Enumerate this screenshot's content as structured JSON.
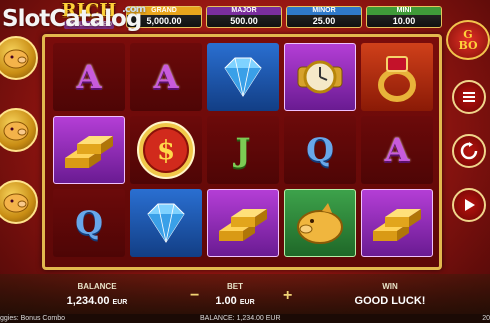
{
  "watermark": {
    "text": "SlotCatalog",
    "suffix": ".com"
  },
  "logo": {
    "title": "RICH",
    "subtitle": "BONUS COMBO"
  },
  "jackpots": [
    {
      "label": "GRAND",
      "value": "5,000.00"
    },
    {
      "label": "MAJOR",
      "value": "500.00"
    },
    {
      "label": "MINOR",
      "value": "25.00"
    },
    {
      "label": "MINI",
      "value": "10.00"
    }
  ],
  "reels": [
    [
      "A",
      "A",
      "diamond",
      "watch",
      "ring"
    ],
    [
      "gold-bars",
      "dollar-coin",
      "J",
      "Q",
      "A"
    ],
    [
      "Q",
      "diamond",
      "gold-bars",
      "golden-pig",
      "gold-bars"
    ]
  ],
  "side_right": {
    "badge_line1": "G",
    "badge_line2": "BO"
  },
  "bottom": {
    "balance_label": "BALANCE",
    "balance_value": "1,234.00",
    "balance_currency": "EUR",
    "bet_label": "BET",
    "bet_value": "1.00",
    "bet_currency": "EUR",
    "win_label": "WIN",
    "win_value": "GOOD LUCK!",
    "minus": "−",
    "plus": "+"
  },
  "status": {
    "game": "ggies: Bonus Combo",
    "balance": "BALANCE: 1,234.00 EUR",
    "time": "20"
  }
}
